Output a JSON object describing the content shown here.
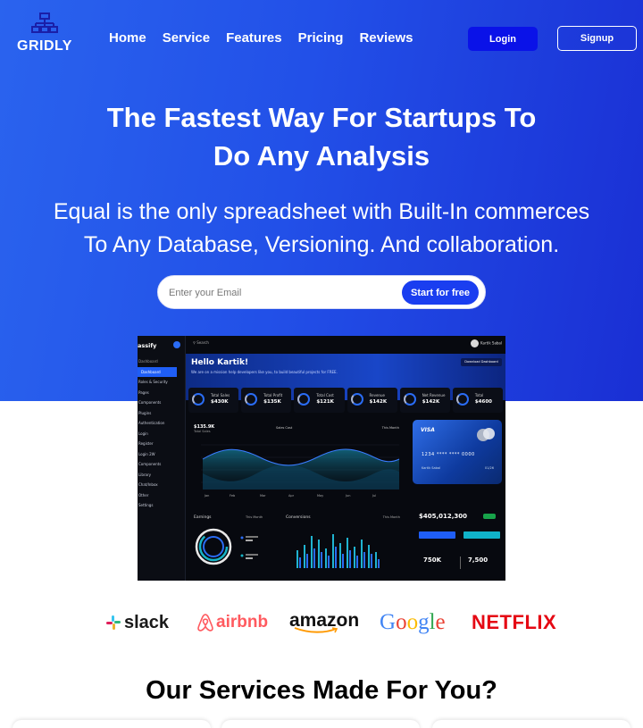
{
  "brand": {
    "name": "GRIDLY",
    "logo_icon": "network-icon"
  },
  "nav": {
    "links": [
      "Home",
      "Service",
      "Features",
      "Pricing",
      "Reviews"
    ],
    "login_label": "Login",
    "signup_label": "Signup"
  },
  "hero": {
    "title_line1": "The Fastest Way For Startups To",
    "title_line2": "Do Any Analysis",
    "subtitle_line1": "Equal is the only spreadsheet with Built-In commerces",
    "subtitle_line2": "To Any Database, Versioning. And collaboration.",
    "email_placeholder": "Enter your Email",
    "cta_label": "Start for free"
  },
  "dashboard": {
    "brand": "assify",
    "search_placeholder": "Search",
    "user_name": "Kartik Sabal",
    "menu": [
      "Dashboard",
      "Roles & Security",
      "Pages",
      "Components",
      "Plugins",
      "Authentication",
      "Login",
      "Register",
      "Login 2W",
      "Components",
      "Library",
      "Chat/Inbox",
      "Other",
      "Settings"
    ],
    "greeting": "Hello Kartik!",
    "greeting_sub": "We are on a mission help developers like you, to build beautiful projects for FREE.",
    "banner_button": "Download Dashboard",
    "stats": [
      {
        "label": "Total Sales",
        "value": "$430K"
      },
      {
        "label": "Total Profit",
        "value": "$135K"
      },
      {
        "label": "Total Cost",
        "value": "$121K"
      },
      {
        "label": "Revenue",
        "value": "$142K"
      },
      {
        "label": "Net Revenue",
        "value": "$142K"
      },
      {
        "label": "Total",
        "value": "$4600"
      }
    ],
    "chart_value": "$135.9K",
    "chart_value_label": "Total Sales",
    "chart_legend": "Sales  Cost",
    "chart_range": "This Month",
    "card_brand": "VISA",
    "card_number": "1234  ****  ****  0000",
    "card_holder": "Kartik Sabal",
    "card_expiry": "01/26",
    "wallet_amount": "$405,012,300",
    "kpi_1": "750K",
    "kpi_2": "7,500",
    "earnings_label": "Earnings",
    "earnings_range": "This Month",
    "conversions_label": "Conversions",
    "conversions_range": "This Month"
  },
  "brands": [
    "slack",
    "airbnb",
    "amazon",
    "Google",
    "NETFLIX"
  ],
  "services": {
    "title": "Our Services Made For You?"
  },
  "colors": {
    "hero_gradient_start": "#2a63ee",
    "hero_gradient_end": "#1a2fd4",
    "login_button": "#0a12e8",
    "cta_button": "#1a3ef0",
    "netflix_red": "#e50914",
    "airbnb_pink": "#ff5a5f"
  }
}
